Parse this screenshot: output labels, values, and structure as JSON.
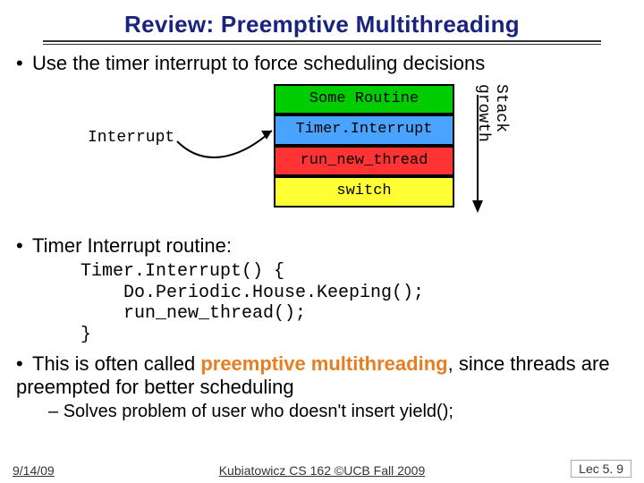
{
  "title": "Review: Preemptive Multithreading",
  "bullet1": "Use the timer interrupt to force scheduling decisions",
  "diagram": {
    "interrupt_label": "Interrupt",
    "stack": [
      "Some Routine",
      "Timer.Interrupt",
      "run_new_thread",
      "switch"
    ],
    "stack_growth": "Stack growth"
  },
  "bullet2": "Timer Interrupt routine:",
  "code": "Timer.Interrupt() {\n    Do.Periodic.House.Keeping();\n    run_new_thread();\n}",
  "bullet3_pre": "This is often called ",
  "bullet3_em": "preemptive multithreading",
  "bullet3_post": ", since threads are preempted for better scheduling",
  "sub3": "Solves problem of user who doesn't insert yield();",
  "footer": {
    "date": "9/14/09",
    "mid": "Kubiatowicz CS 162 ©UCB Fall 2009",
    "lec": "Lec 5. 9"
  }
}
